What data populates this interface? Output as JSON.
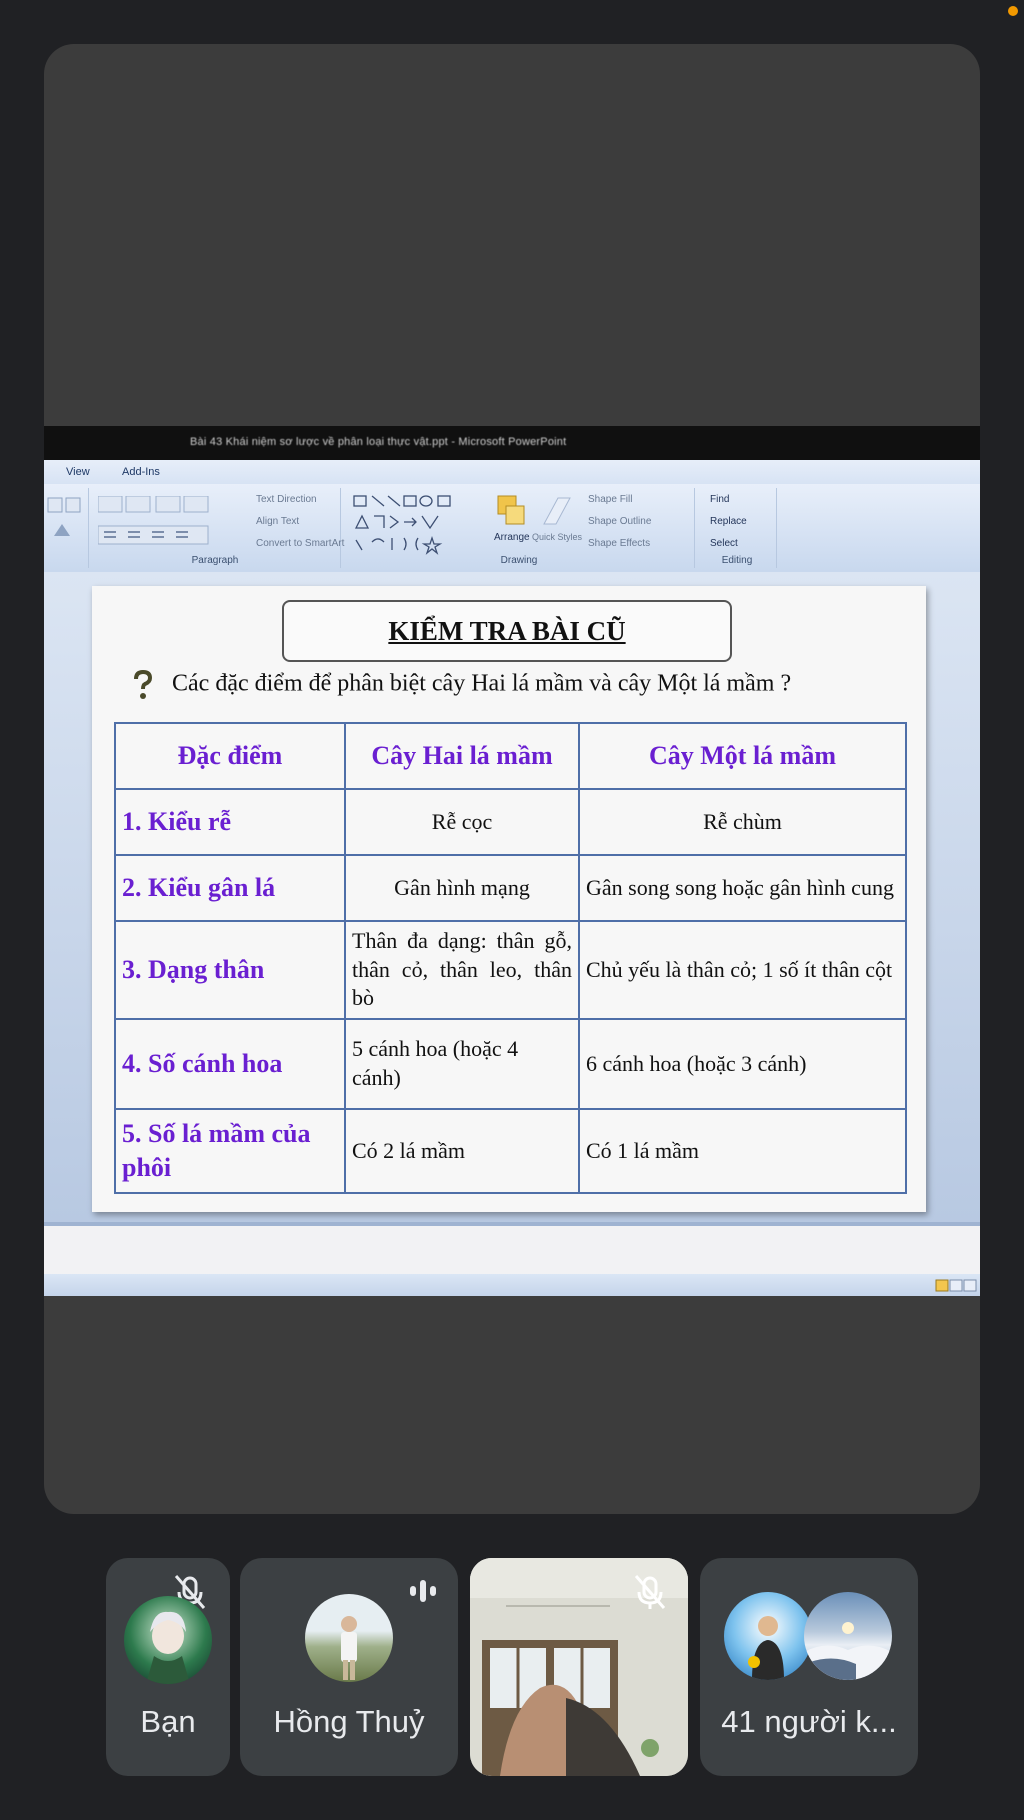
{
  "window": {
    "title": "Bài 43 Khái niệm sơ lược về phân loại thực vật.ppt - Microsoft PowerPoint"
  },
  "ppt": {
    "menu": [
      "View",
      "Add-Ins"
    ],
    "ribbon": {
      "paragraph": {
        "items": [
          "Text Direction",
          "Align Text",
          "Convert to SmartArt"
        ],
        "label": "Paragraph"
      },
      "drawing": {
        "arrange": "Arrange",
        "quick_styles": "Quick Styles",
        "shape_fill": "Shape Fill",
        "shape_outline": "Shape Outline",
        "shape_effects": "Shape Effects",
        "label": "Drawing"
      },
      "editing": {
        "find": "Find",
        "replace": "Replace",
        "select": "Select",
        "label": "Editing"
      }
    }
  },
  "slide": {
    "title": "KIỂM TRA BÀI CŨ",
    "question": "Các đặc điểm để phân biệt cây Hai lá mầm và cây Một lá mầm ?",
    "table": {
      "headers": [
        "Đặc điểm",
        "Cây Hai lá mầm",
        "Cây Một lá mầm"
      ],
      "rows": [
        [
          "1. Kiểu rễ",
          "Rễ cọc",
          "Rễ chùm"
        ],
        [
          "2. Kiểu gân lá",
          "Gân hình mạng",
          "Gân song song hoặc gân hình cung"
        ],
        [
          "3. Dạng thân",
          "Thân đa dạng: thân gỗ, thân cỏ, thân leo, thân bò",
          "Chủ yếu là thân cỏ; 1 số ít thân cột"
        ],
        [
          "4. Số cánh hoa",
          "5 cánh hoa (hoặc 4 cánh)",
          "6 cánh hoa (hoặc 3 cánh)"
        ],
        [
          "5. Số lá mầm của phôi",
          "Có 2 lá mầm",
          "Có 1 lá mầm"
        ]
      ]
    }
  },
  "participants": [
    {
      "name": "Bạn",
      "muted": true
    },
    {
      "name": "Hồng Thuỷ",
      "muted": false,
      "speaking": true
    },
    {
      "name": "",
      "muted": true,
      "video": true
    },
    {
      "name": "41 người k...",
      "muted": false
    }
  ],
  "colors": {
    "background": "#202124",
    "tile": "#3c4043",
    "accent_dot": "#f29900",
    "slide_purple": "#6a1fd1",
    "table_border": "#4f6fa8"
  }
}
